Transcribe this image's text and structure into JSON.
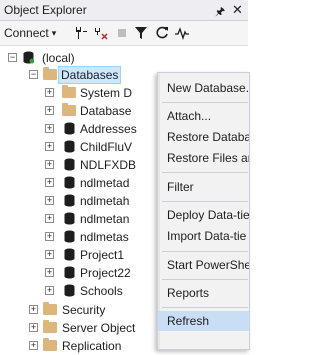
{
  "window": {
    "title": "Object Explorer",
    "pin_icon": "pin-icon",
    "close_icon": "close-icon"
  },
  "toolbar": {
    "connect_label": "Connect",
    "chevron": "▾",
    "icons": [
      "connect-icon",
      "disconnect-icon",
      "stop-icon",
      "filter-icon",
      "refresh-icon",
      "activity-monitor-icon"
    ]
  },
  "tree": {
    "server": "(local)",
    "databases": "Databases",
    "children": [
      "System D",
      "Database",
      "Addresses",
      "ChildFluV",
      "NDLFXDB",
      "ndlmetad",
      "ndlmetah",
      "ndlmetan",
      "ndlmetas",
      "Project1",
      "Project22",
      "Schools"
    ],
    "siblings": [
      "Security",
      "Server Object",
      "Replication"
    ]
  },
  "context_menu": {
    "items": [
      "New Database...",
      "Attach...",
      "Restore Databas",
      "Restore Files an",
      "Filter",
      "Deploy Data-tie",
      "Import Data-tie",
      "Start PowerShe",
      "Reports",
      "Refresh"
    ],
    "highlighted": "Refresh"
  },
  "colors": {
    "selection": "#cce8ff",
    "menu_highlight": "#c9def5",
    "folder": "#dcb67a"
  }
}
